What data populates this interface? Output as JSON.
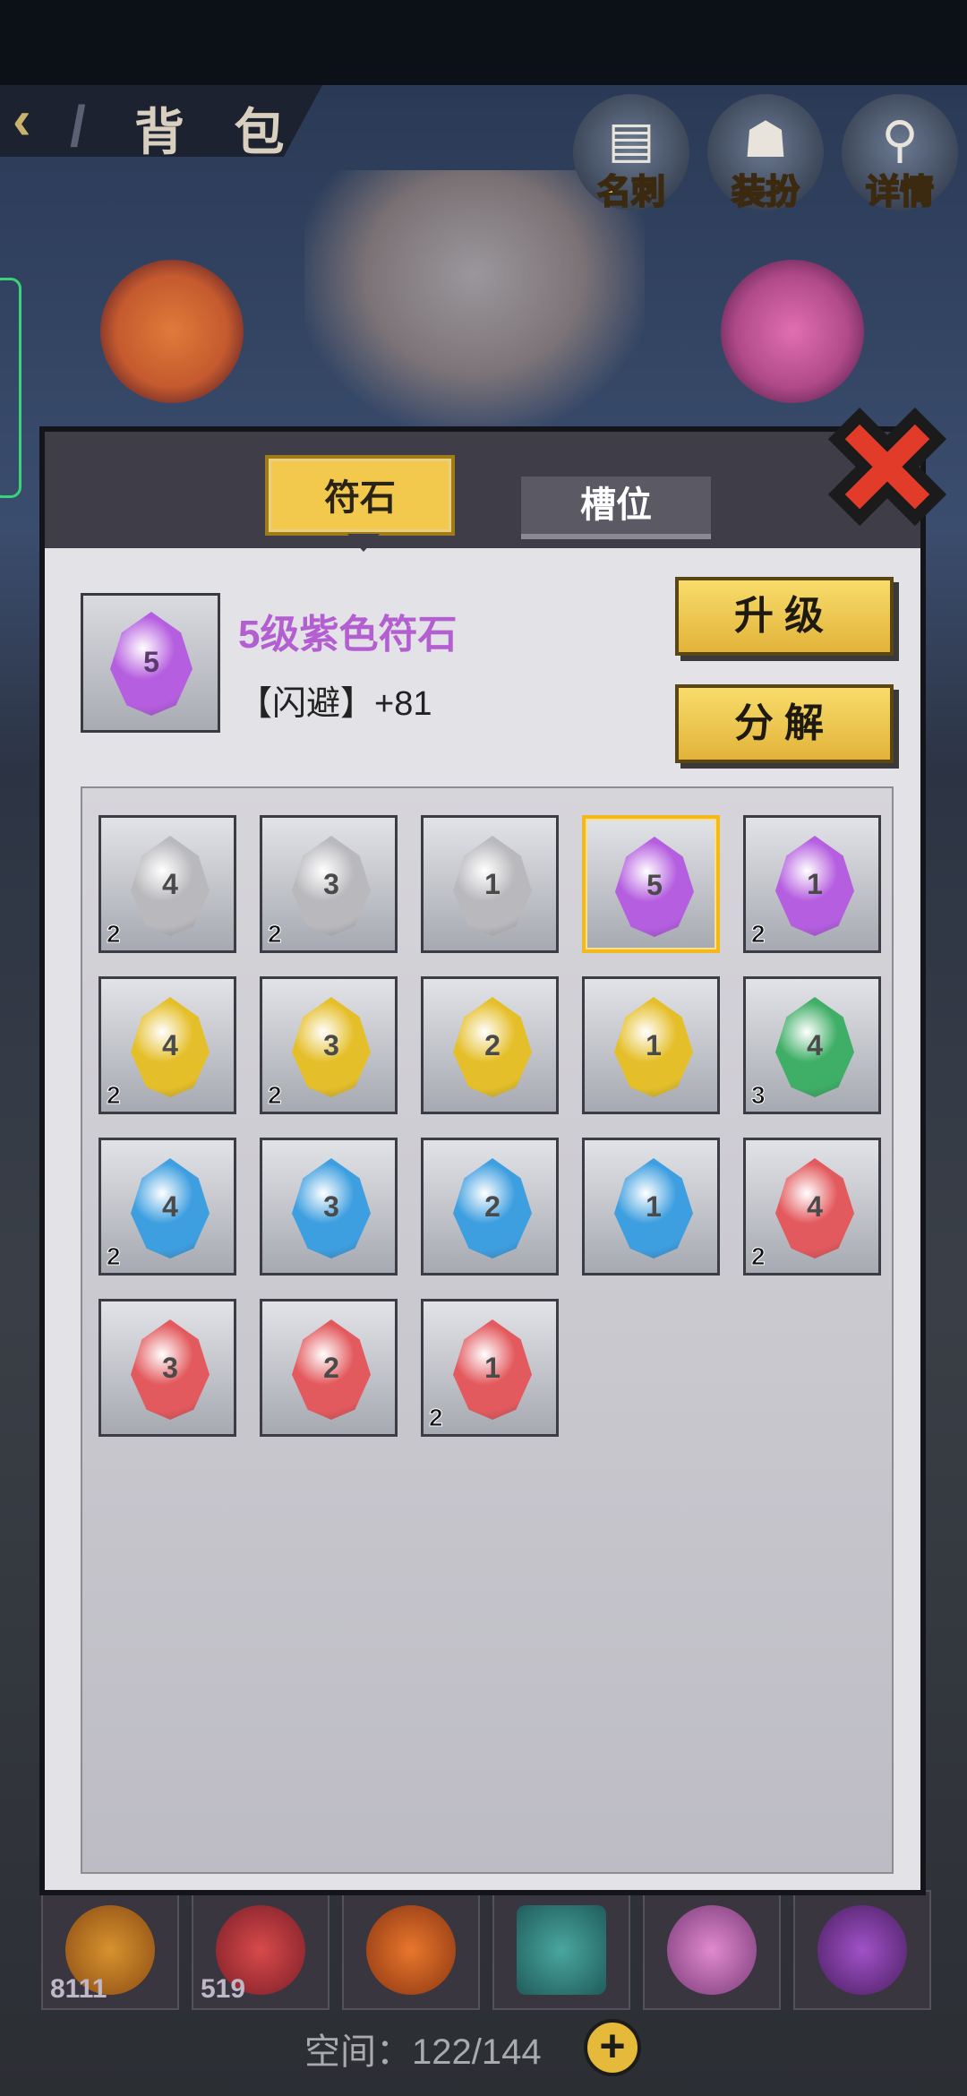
{
  "header": {
    "back_icon": "chevron-left-icon",
    "title": "背 包",
    "buttons": [
      {
        "label": "名刺",
        "icon": "card-icon"
      },
      {
        "label": "装扮",
        "icon": "assassin-icon"
      },
      {
        "label": "详情",
        "icon": "search-icon"
      }
    ]
  },
  "modal": {
    "tabs": [
      {
        "label": "符石",
        "active": true
      },
      {
        "label": "槽位",
        "active": false
      }
    ],
    "selected": {
      "level": "5",
      "color": "#b55ee0",
      "name": "5级紫色符石",
      "stat": "【闪避】+81"
    },
    "buttons": {
      "upgrade": "升级",
      "dismantle": "分解"
    },
    "close_icon": "close-x-icon",
    "runes": [
      {
        "level": "4",
        "color": "#b9b9bd",
        "count": "2"
      },
      {
        "level": "3",
        "color": "#b9b9bd",
        "count": "2"
      },
      {
        "level": "1",
        "color": "#b9b9bd",
        "count": ""
      },
      {
        "level": "5",
        "color": "#b55ee0",
        "count": "",
        "selected": true
      },
      {
        "level": "1",
        "color": "#b55ee0",
        "count": "2"
      },
      {
        "level": "4",
        "color": "#e5bf2a",
        "count": "2"
      },
      {
        "level": "3",
        "color": "#e5bf2a",
        "count": "2"
      },
      {
        "level": "2",
        "color": "#e5bf2a",
        "count": ""
      },
      {
        "level": "1",
        "color": "#e5bf2a",
        "count": ""
      },
      {
        "level": "4",
        "color": "#3fae66",
        "count": "3"
      },
      {
        "level": "4",
        "color": "#3e9fe0",
        "count": "2"
      },
      {
        "level": "3",
        "color": "#3e9fe0",
        "count": ""
      },
      {
        "level": "2",
        "color": "#3e9fe0",
        "count": ""
      },
      {
        "level": "1",
        "color": "#3e9fe0",
        "count": ""
      },
      {
        "level": "4",
        "color": "#e35a5e",
        "count": "2"
      },
      {
        "level": "3",
        "color": "#e35a5e",
        "count": ""
      },
      {
        "level": "2",
        "color": "#e35a5e",
        "count": ""
      },
      {
        "level": "1",
        "color": "#e35a5e",
        "count": "2"
      }
    ]
  },
  "inventory": {
    "counts": [
      "8111",
      "519"
    ],
    "space_label": "空间：",
    "space_value": "122/144"
  }
}
